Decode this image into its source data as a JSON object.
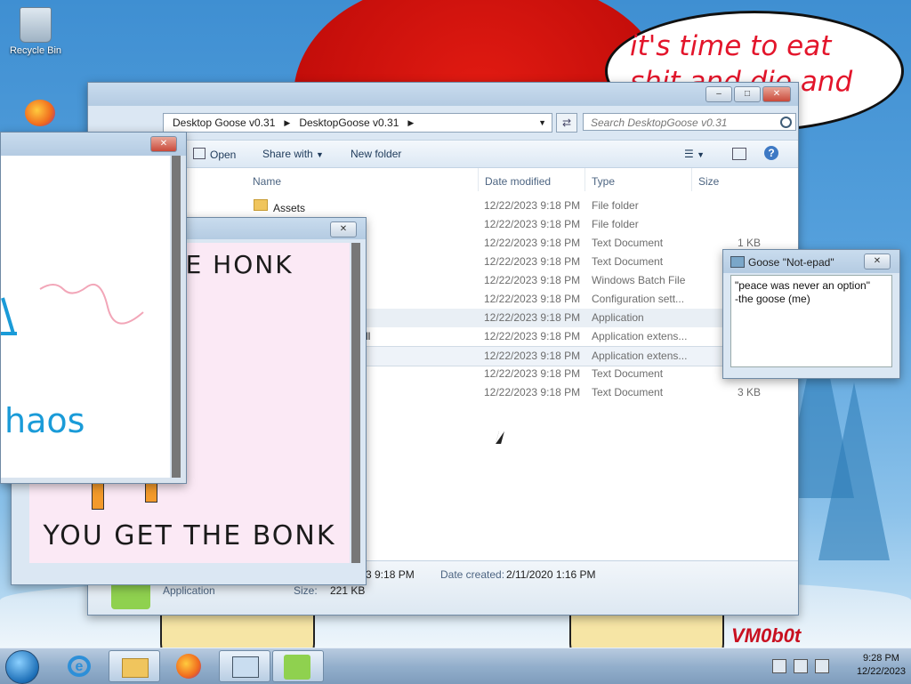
{
  "desktop": {
    "recycle_bin_label": "Recycle Bin",
    "speech_bubble": "it's time to eat shit and die and chew",
    "signature": "VM0b0t"
  },
  "explorer": {
    "breadcrumb": [
      "Desktop Goose v0.31",
      "DesktopGoose v0.31"
    ],
    "search_placeholder": "Search DesktopGoose v0.31",
    "toolbar": {
      "open": "Open",
      "share_with": "Share with",
      "new_folder": "New folder"
    },
    "columns": {
      "name": "Name",
      "date": "Date modified",
      "type": "Type",
      "size": "Size"
    },
    "rows": [
      {
        "name": "Assets",
        "date": "12/22/2023 9:18 PM",
        "type": "File folder",
        "size": ""
      },
      {
        "name": "",
        "date": "12/22/2023 9:18 PM",
        "type": "File folder",
        "size": ""
      },
      {
        "name": "",
        "date": "12/22/2023 9:18 PM",
        "type": "Text Document",
        "size": "1 KB"
      },
      {
        "name": "",
        "date": "12/22/2023 9:18 PM",
        "type": "Text Document",
        "size": ""
      },
      {
        "name": "",
        "date": "12/22/2023 9:18 PM",
        "type": "Windows Batch File",
        "size": ""
      },
      {
        "name": "",
        "date": "12/22/2023 9:18 PM",
        "type": "Configuration sett...",
        "size": ""
      },
      {
        "name": "",
        "date": "12/22/2023 9:18 PM",
        "type": "Application",
        "size": ""
      },
      {
        "name": "ll",
        "date": "12/22/2023 9:18 PM",
        "type": "Application extens...",
        "size": ""
      },
      {
        "name": "",
        "date": "12/22/2023 9:18 PM",
        "type": "Application extens...",
        "size": ""
      },
      {
        "name": "",
        "date": "12/22/2023 9:18 PM",
        "type": "Text Document",
        "size": ""
      },
      {
        "name": "",
        "date": "12/22/2023 9:18 PM",
        "type": "Text Document",
        "size": "3 KB"
      }
    ],
    "details": {
      "modified_partial": "3 9:18 PM",
      "date_created_label": "Date created:",
      "date_created": "2/11/2020 1:16 PM",
      "type": "Application",
      "size_label": "Size:",
      "size": "221 KB"
    }
  },
  "paint_window": {
    "scribble_text": "haos"
  },
  "honk_image": {
    "top_text": "THE HONK",
    "bottom_text": "YOU GET THE BONK"
  },
  "goose_notepad": {
    "title": "Goose \"Not-epad\"",
    "text": "\"peace was never an option\"\n   -the goose (me)"
  },
  "taskbar": {
    "time": "9:28 PM",
    "date": "12/22/2023"
  }
}
